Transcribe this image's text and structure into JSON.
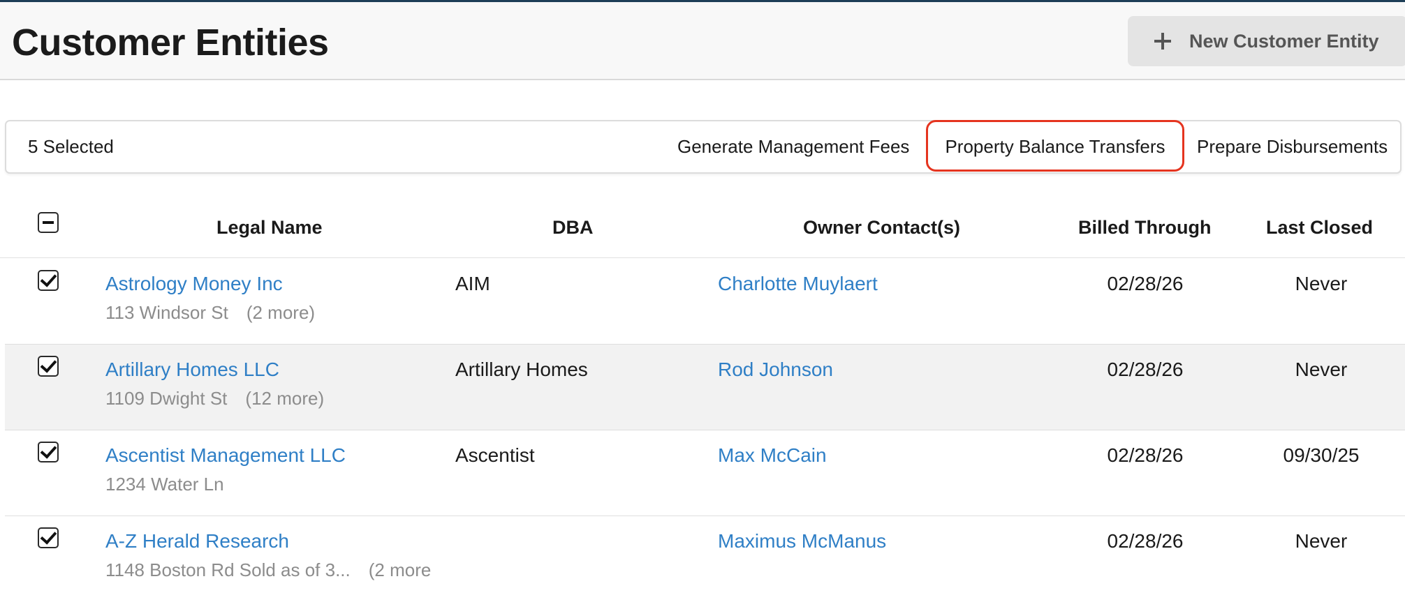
{
  "page": {
    "title": "Customer Entities",
    "new_button_label": "New Customer Entity"
  },
  "bulk_bar": {
    "selected_text": "5 Selected",
    "actions": [
      "Generate Management Fees",
      "Property Balance Transfers",
      "Prepare Disbursements"
    ],
    "highlighted_action": "Property Balance Transfers",
    "highlight_color": "#e5341f"
  },
  "table": {
    "columns": [
      "Legal Name",
      "DBA",
      "Owner Contact(s)",
      "Billed Through",
      "Last Closed"
    ],
    "header_checkbox_state": "indeterminate",
    "rows": [
      {
        "checked": true,
        "legal_name": "Astrology Money Inc",
        "address": "113 Windsor St",
        "more": "(2 more)",
        "dba": "AIM",
        "owner": "Charlotte Muylaert",
        "billed_through": "02/28/26",
        "last_closed": "Never"
      },
      {
        "checked": true,
        "legal_name": "Artillary Homes LLC",
        "address": "1109 Dwight St",
        "more": "(12 more)",
        "dba": "Artillary Homes",
        "owner": "Rod Johnson",
        "billed_through": "02/28/26",
        "last_closed": "Never"
      },
      {
        "checked": true,
        "legal_name": "Ascentist Management LLC",
        "address": "1234 Water Ln",
        "more": "",
        "dba": "Ascentist",
        "owner": "Max McCain",
        "billed_through": "02/28/26",
        "last_closed": "09/30/25"
      },
      {
        "checked": true,
        "legal_name": "A-Z Herald Research",
        "address": "1148 Boston Rd Sold as of 3...",
        "more": "(2 more",
        "dba": "",
        "owner": "Maximus McManus",
        "billed_through": "02/28/26",
        "last_closed": "Never"
      }
    ]
  },
  "colors": {
    "link": "#2f7fc6",
    "header_band": "#f8f8f8",
    "top_line": "#1d3e57",
    "row_alt": "#f2f2f2"
  }
}
